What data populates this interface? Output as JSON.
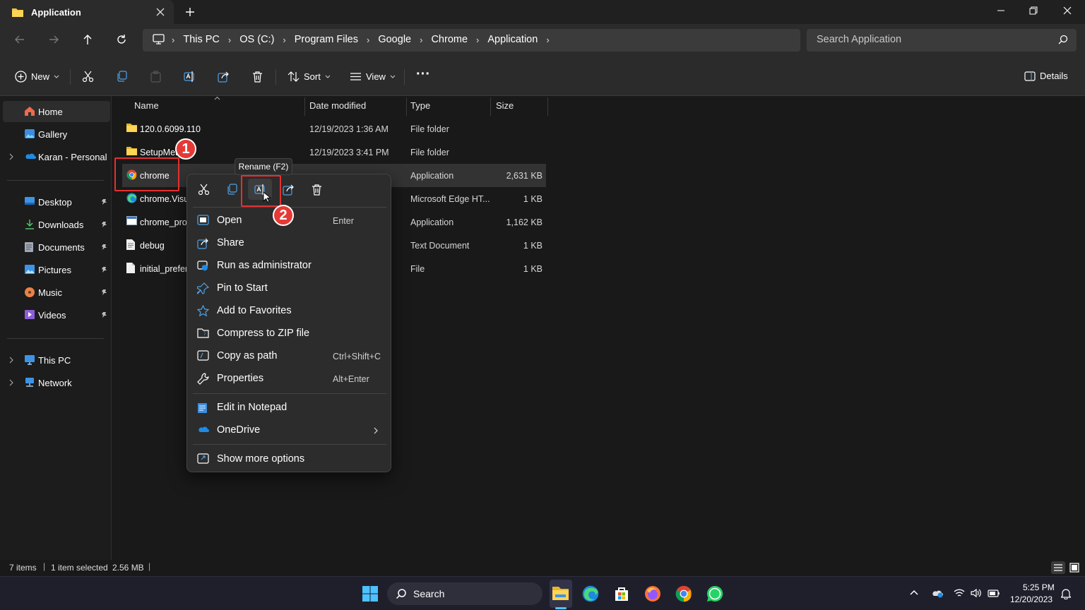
{
  "window": {
    "tab_title": "Application",
    "new_tab": "+"
  },
  "nav": {
    "breadcrumbs": [
      "This PC",
      "OS (C:)",
      "Program Files",
      "Google",
      "Chrome",
      "Application"
    ],
    "search_placeholder": "Search Application"
  },
  "toolbar": {
    "new_label": "New",
    "sort_label": "Sort",
    "view_label": "View",
    "more_label": "···",
    "details_label": "Details"
  },
  "sidebar": {
    "home": "Home",
    "gallery": "Gallery",
    "onedrive": "Karan - Personal",
    "desktop": "Desktop",
    "downloads": "Downloads",
    "documents": "Documents",
    "pictures": "Pictures",
    "music": "Music",
    "videos": "Videos",
    "thispc": "This PC",
    "network": "Network"
  },
  "columns": {
    "name": "Name",
    "date": "Date modified",
    "type": "Type",
    "size": "Size"
  },
  "files": [
    {
      "name": "120.0.6099.110",
      "date": "12/19/2023 1:36 AM",
      "type": "File folder",
      "size": "",
      "icon": "folder-icon"
    },
    {
      "name": "SetupMet",
      "date": "12/19/2023 3:41 PM",
      "type": "File folder",
      "size": "",
      "icon": "folder-icon"
    },
    {
      "name": "chrome",
      "date": "",
      "type": "Application",
      "size": "2,631 KB",
      "icon": "chrome-icon"
    },
    {
      "name": "chrome.Visu",
      "date": "",
      "type": "Microsoft Edge HT...",
      "size": "1 KB",
      "icon": "edge-icon"
    },
    {
      "name": "chrome_prox",
      "date": "",
      "type": "Application",
      "size": "1,162 KB",
      "icon": "app-icon"
    },
    {
      "name": "debug",
      "date": "",
      "type": "Text Document",
      "size": "1 KB",
      "icon": "text-file-icon"
    },
    {
      "name": "initial_prefer",
      "date": "",
      "type": "File",
      "size": "1 KB",
      "icon": "file-icon"
    }
  ],
  "context_menu": {
    "tooltip": "Rename (F2)",
    "items": {
      "open": {
        "label": "Open",
        "shortcut": "Enter"
      },
      "share": {
        "label": "Share"
      },
      "run_admin": {
        "label": "Run as administrator"
      },
      "pin_start": {
        "label": "Pin to Start"
      },
      "favorites": {
        "label": "Add to Favorites"
      },
      "zip": {
        "label": "Compress to ZIP file"
      },
      "copy_path": {
        "label": "Copy as path",
        "shortcut": "Ctrl+Shift+C"
      },
      "properties": {
        "label": "Properties",
        "shortcut": "Alt+Enter"
      },
      "notepad": {
        "label": "Edit in Notepad"
      },
      "onedrive": {
        "label": "OneDrive"
      },
      "more": {
        "label": "Show more options"
      }
    }
  },
  "annotations": {
    "step1": "1",
    "step2": "2",
    "color": "#e5302f"
  },
  "status": {
    "items": "7 items",
    "selected": "1 item selected",
    "size": "2.56 MB"
  },
  "taskbar": {
    "search": "Search",
    "time": "5:25 PM",
    "date": "12/20/2023"
  }
}
